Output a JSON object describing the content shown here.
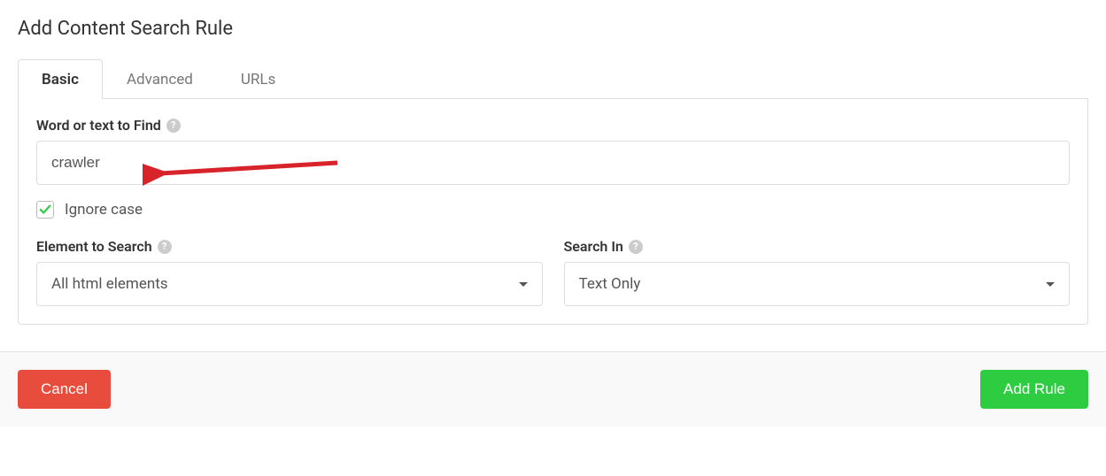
{
  "header": {
    "title": "Add Content Search Rule"
  },
  "tabs": [
    {
      "label": "Basic",
      "active": true
    },
    {
      "label": "Advanced",
      "active": false
    },
    {
      "label": "URLs",
      "active": false
    }
  ],
  "form": {
    "find": {
      "label": "Word or text to Find",
      "value": "crawler"
    },
    "ignore_case": {
      "label": "Ignore case",
      "checked": true
    },
    "element_to_search": {
      "label": "Element to Search",
      "value": "All html elements"
    },
    "search_in": {
      "label": "Search In",
      "value": "Text Only"
    }
  },
  "footer": {
    "cancel_label": "Cancel",
    "add_label": "Add Rule"
  },
  "annotation": {
    "has_arrow": true
  }
}
